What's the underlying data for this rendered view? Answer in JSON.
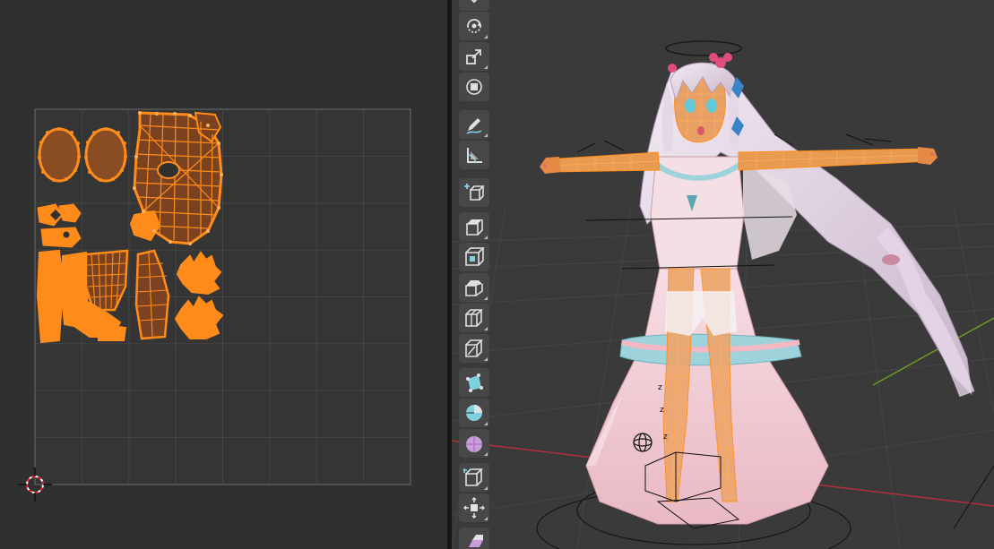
{
  "app": {
    "accent_color": "#ff8c1a",
    "selection_fill": "#ff8c1a",
    "uv_editor_bg": "#303030",
    "viewport_bg": "#3a3a3a",
    "x_axis_color": "#b0313c",
    "y_axis_color": "#6a9a23"
  },
  "uv_editor": {
    "grid_divisions": 8,
    "cursor_icon": "2d-cursor-icon",
    "islands_icon": "uv-islands"
  },
  "viewport": {
    "model_icon": "character-model",
    "toolbar": [
      {
        "name": "tool-transform-collapsed",
        "icon": "chevron-down-icon",
        "active": false
      },
      {
        "name": "tool-rotate",
        "icon": "rotate-icon",
        "active": false
      },
      {
        "name": "tool-scale",
        "icon": "scale-icon",
        "active": false
      },
      {
        "name": "tool-transform",
        "icon": "transform-icon",
        "active": false
      },
      {
        "name": "tool-annotate",
        "icon": "annotate-icon",
        "active": false
      },
      {
        "name": "tool-measure",
        "icon": "measure-icon",
        "active": false
      },
      {
        "name": "tool-add-cube",
        "icon": "add-cube-icon",
        "active": false
      },
      {
        "name": "tool-extrude-region",
        "icon": "extrude-icon",
        "active": false
      },
      {
        "name": "tool-inset-faces",
        "icon": "inset-icon",
        "active": false
      },
      {
        "name": "tool-bevel",
        "icon": "bevel-icon",
        "active": false
      },
      {
        "name": "tool-loop-cut",
        "icon": "loop-cut-icon",
        "active": false
      },
      {
        "name": "tool-knife",
        "icon": "knife-icon",
        "active": false
      },
      {
        "name": "tool-poly-build",
        "icon": "poly-build-icon",
        "active": false
      },
      {
        "name": "tool-spin",
        "icon": "spin-icon",
        "active": false
      },
      {
        "name": "tool-smooth",
        "icon": "smooth-icon",
        "active": false
      },
      {
        "name": "tool-edge-slide",
        "icon": "edge-slide-icon",
        "active": false
      },
      {
        "name": "tool-shrink-fatten",
        "icon": "shrink-fatten-icon",
        "active": false
      },
      {
        "name": "tool-shear",
        "icon": "shear-icon",
        "active": false
      }
    ]
  }
}
